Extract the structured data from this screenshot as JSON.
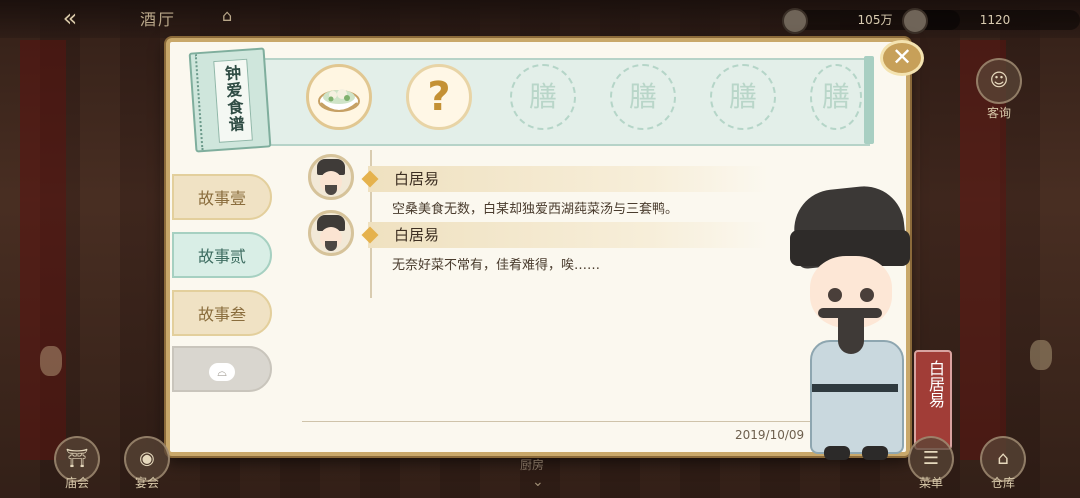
{
  "topbar": {
    "back_icon": "back-arrow-icon",
    "title": "酒厅",
    "resources": [
      {
        "icon": "leaf-currency-icon",
        "value": "105万"
      },
      {
        "icon": "jade-coin-icon",
        "value": "1120"
      }
    ]
  },
  "panel": {
    "book_title": "钟爱食谱",
    "recipe_slots": [
      {
        "state": "dish",
        "icon": "soup-bowl-icon"
      },
      {
        "state": "unknown",
        "symbol": "?"
      },
      {
        "state": "locked",
        "symbol": "膳"
      },
      {
        "state": "locked",
        "symbol": "膳"
      },
      {
        "state": "locked",
        "symbol": "膳"
      },
      {
        "state": "locked",
        "symbol": "膳"
      }
    ],
    "tabs": [
      {
        "label": "故事壹",
        "selected": false
      },
      {
        "label": "故事贰",
        "selected": true
      },
      {
        "label": "故事叁",
        "selected": false
      },
      {
        "label": "",
        "locked": true
      }
    ],
    "dialogue": [
      {
        "speaker": "白居易",
        "text": "空桑美食无数，白某却独爱西湖莼菜汤与三套鸭。"
      },
      {
        "speaker": "白居易",
        "text": "无奈好菜不常有，佳肴难得，唉……"
      }
    ],
    "date": "2019/10/09"
  },
  "character": {
    "name": "白居易"
  },
  "side_buttons": {
    "guest": "客询",
    "menu": "菜单",
    "storage": "仓库",
    "banquet": "庙会",
    "feast": "宴会",
    "kitchen": "厨房"
  }
}
